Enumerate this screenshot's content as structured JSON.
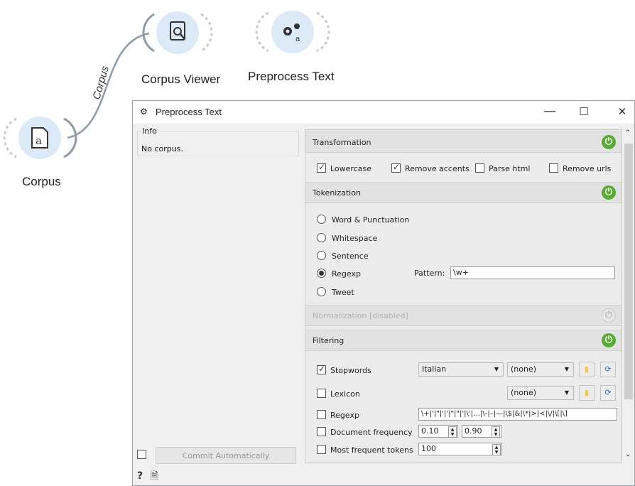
{
  "canvas": {
    "widgets": [
      {
        "name": "corpus-viewer",
        "label": "Corpus Viewer"
      },
      {
        "name": "preprocess-text",
        "label": "Preprocess Text"
      },
      {
        "name": "corpus",
        "label": "Corpus"
      }
    ],
    "link_label": "Corpus"
  },
  "window": {
    "title": "Preprocess Text",
    "minimize": "—",
    "maximize": "☐",
    "close": "✕"
  },
  "info": {
    "caption": "Info",
    "text": "No corpus."
  },
  "commit": {
    "label": "Commit Automatically",
    "checked": false
  },
  "transformation": {
    "title": "Transformation",
    "options": [
      {
        "label": "Lowercase",
        "checked": true
      },
      {
        "label": "Remove accents",
        "checked": true
      },
      {
        "label": "Parse html",
        "checked": false
      },
      {
        "label": "Remove urls",
        "checked": false
      }
    ]
  },
  "tokenization": {
    "title": "Tokenization",
    "options": [
      {
        "label": "Word & Punctuation",
        "selected": false
      },
      {
        "label": "Whitespace",
        "selected": false
      },
      {
        "label": "Sentence",
        "selected": false
      },
      {
        "label": "Regexp",
        "selected": true
      },
      {
        "label": "Tweet",
        "selected": false
      }
    ],
    "pattern_label": "Pattern:",
    "pattern_value": "\\w+"
  },
  "normalization": {
    "title": "Normalization  [disabled]"
  },
  "filtering": {
    "title": "Filtering",
    "stopwords": {
      "label": "Stopwords",
      "checked": true,
      "language": "Italian",
      "file": "(none)"
    },
    "lexicon": {
      "label": "Lexicon",
      "checked": false,
      "file": "(none)"
    },
    "regexp": {
      "label": "Regexp",
      "checked": false,
      "value": "\\+|'|\"|'|'|\"|\"|'|\\'|…|\\-|–|—|\\$|&|\\*|>|<|\\/|\\[|\\]"
    },
    "doc_freq": {
      "label": "Document frequency",
      "checked": false,
      "min": "0.10",
      "max": "0.90"
    },
    "most_frequent": {
      "label": "Most frequent tokens",
      "checked": false,
      "value": "100"
    }
  },
  "colors": {
    "power_on": "#5aab35",
    "node_bg": "#dce9f7"
  }
}
